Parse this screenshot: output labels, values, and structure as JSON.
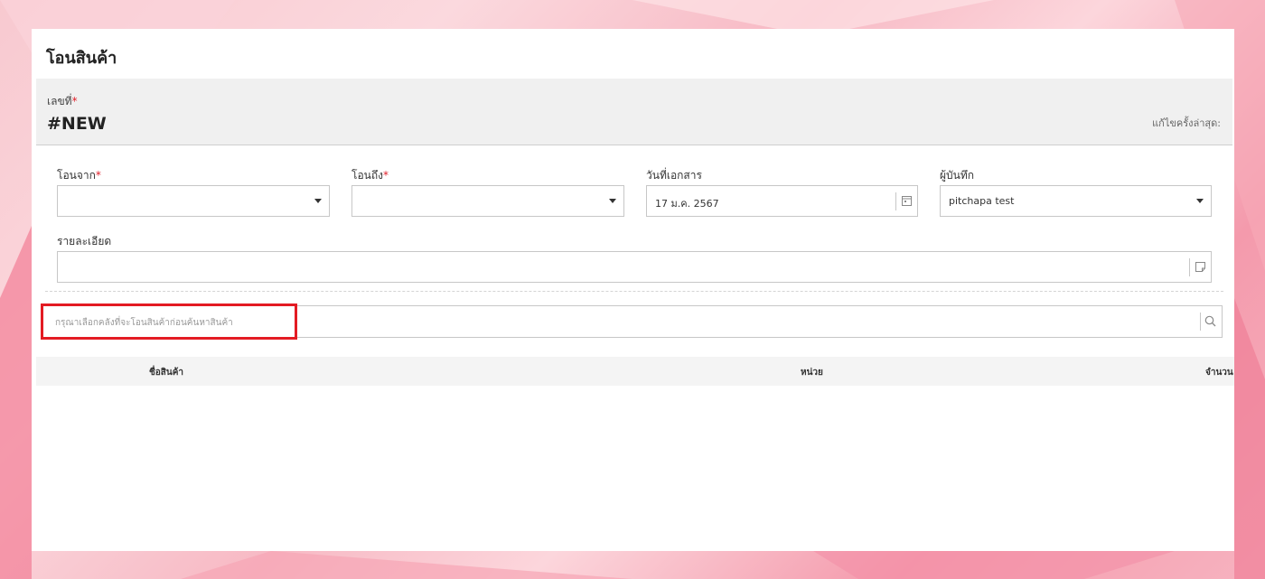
{
  "page": {
    "title": "โอนสินค้า"
  },
  "document": {
    "number_label": "เลขที่",
    "required_mark": "*",
    "number_value": "#NEW",
    "last_edited_label": "แก้ไขครั้งล่าสุด:"
  },
  "form": {
    "from_label": "โอนจาก",
    "from_value": "",
    "to_label": "โอนถึง",
    "to_value": "",
    "date_label": "วันที่เอกสาร",
    "date_value": "17 ม.ค. 2567",
    "recorder_label": "ผู้บันทึก",
    "recorder_value": "pitchapa test",
    "details_label": "รายละเอียด",
    "details_value": ""
  },
  "search": {
    "placeholder": "กรุณาเลือกคลังที่จะโอนสินค้าก่อนค้นหาสินค้า"
  },
  "table": {
    "columns": [
      "ชื่อสินค้า",
      "หน่วย",
      "จำนวน"
    ],
    "rows": []
  },
  "colors": {
    "required": "#e0202b",
    "highlight": "#e31b23",
    "background_pink": "#f7b9c4"
  },
  "icons": {
    "date_field": "calendar-icon",
    "details_field": "note-icon",
    "search_field": "search-icon",
    "dropdowns": "caret-down-icon"
  }
}
